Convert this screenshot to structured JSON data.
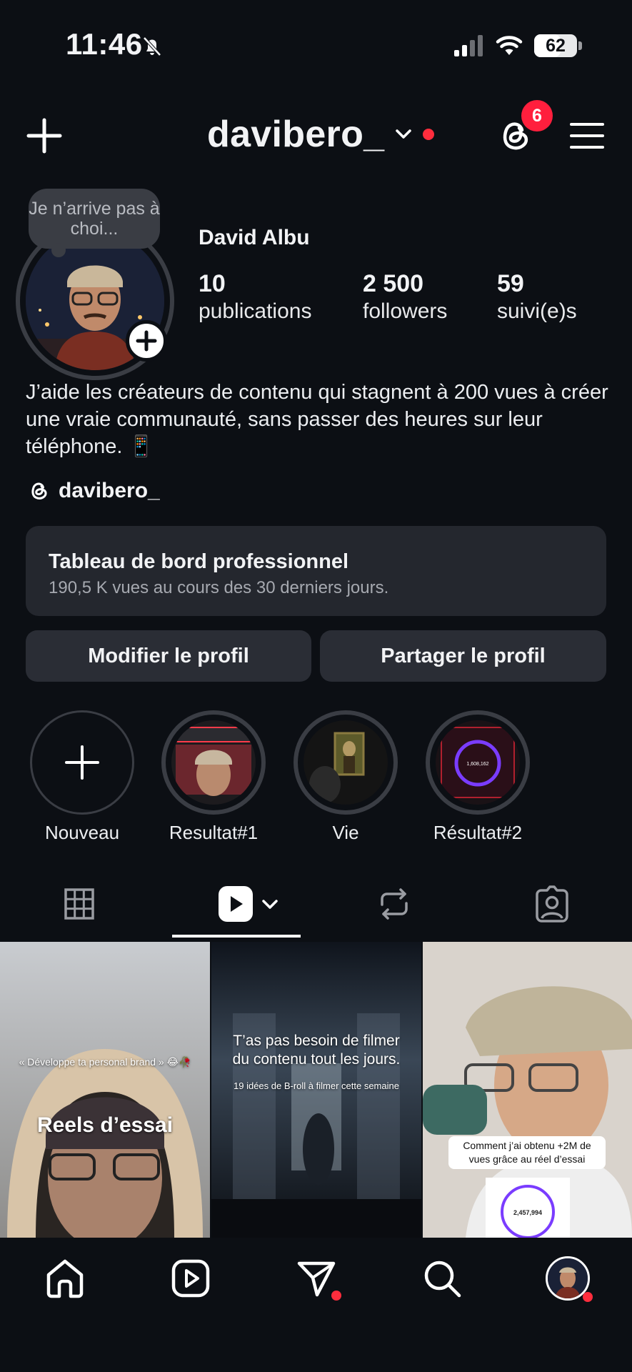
{
  "status_bar": {
    "time": "11:46",
    "battery": "62",
    "battery_level": 0.62
  },
  "header": {
    "username": "davibero_",
    "threads_badge": "6"
  },
  "profile": {
    "note": "Je n’arrive pas à choi...",
    "name": "David Albu",
    "stats": [
      {
        "value": "10",
        "label": "publications"
      },
      {
        "value": "2 500",
        "label": "followers"
      },
      {
        "value": "59",
        "label": "suivi(e)s"
      }
    ],
    "bio": "J’aide les créateurs de contenu qui stagnent à 200 vues à créer une vraie communauté, sans passer des heures sur leur téléphone. 📱",
    "threads_handle": "davibero_"
  },
  "dashboard": {
    "title": "Tableau de bord professionnel",
    "subtitle": "190,5 K vues au cours des 30 derniers jours."
  },
  "buttons": {
    "edit": "Modifier le profil",
    "share": "Partager le profil"
  },
  "highlights": [
    {
      "label": "Nouveau"
    },
    {
      "label": "Resultat#1"
    },
    {
      "label": "Vie"
    },
    {
      "label": "Résultat#2",
      "counter": "1,608,162"
    }
  ],
  "grid": [
    {
      "caption_small": "« Développe ta personal brand » 😂🥀",
      "caption_big": "Reels d’essai"
    },
    {
      "caption_big": "T’as pas besoin de filmer du contenu tout les jours.",
      "caption_small": "19 idées de B-roll à filmer cette semaine"
    },
    {
      "caption_big": "Comment j’ai obtenu +2M de vues grâce au réel d’essai",
      "counter": "2,457,994"
    }
  ],
  "colors": {
    "background": "#0c0f14",
    "notification_red": "#ff2d3d",
    "card": "#24272e",
    "button": "#2a2d35"
  }
}
